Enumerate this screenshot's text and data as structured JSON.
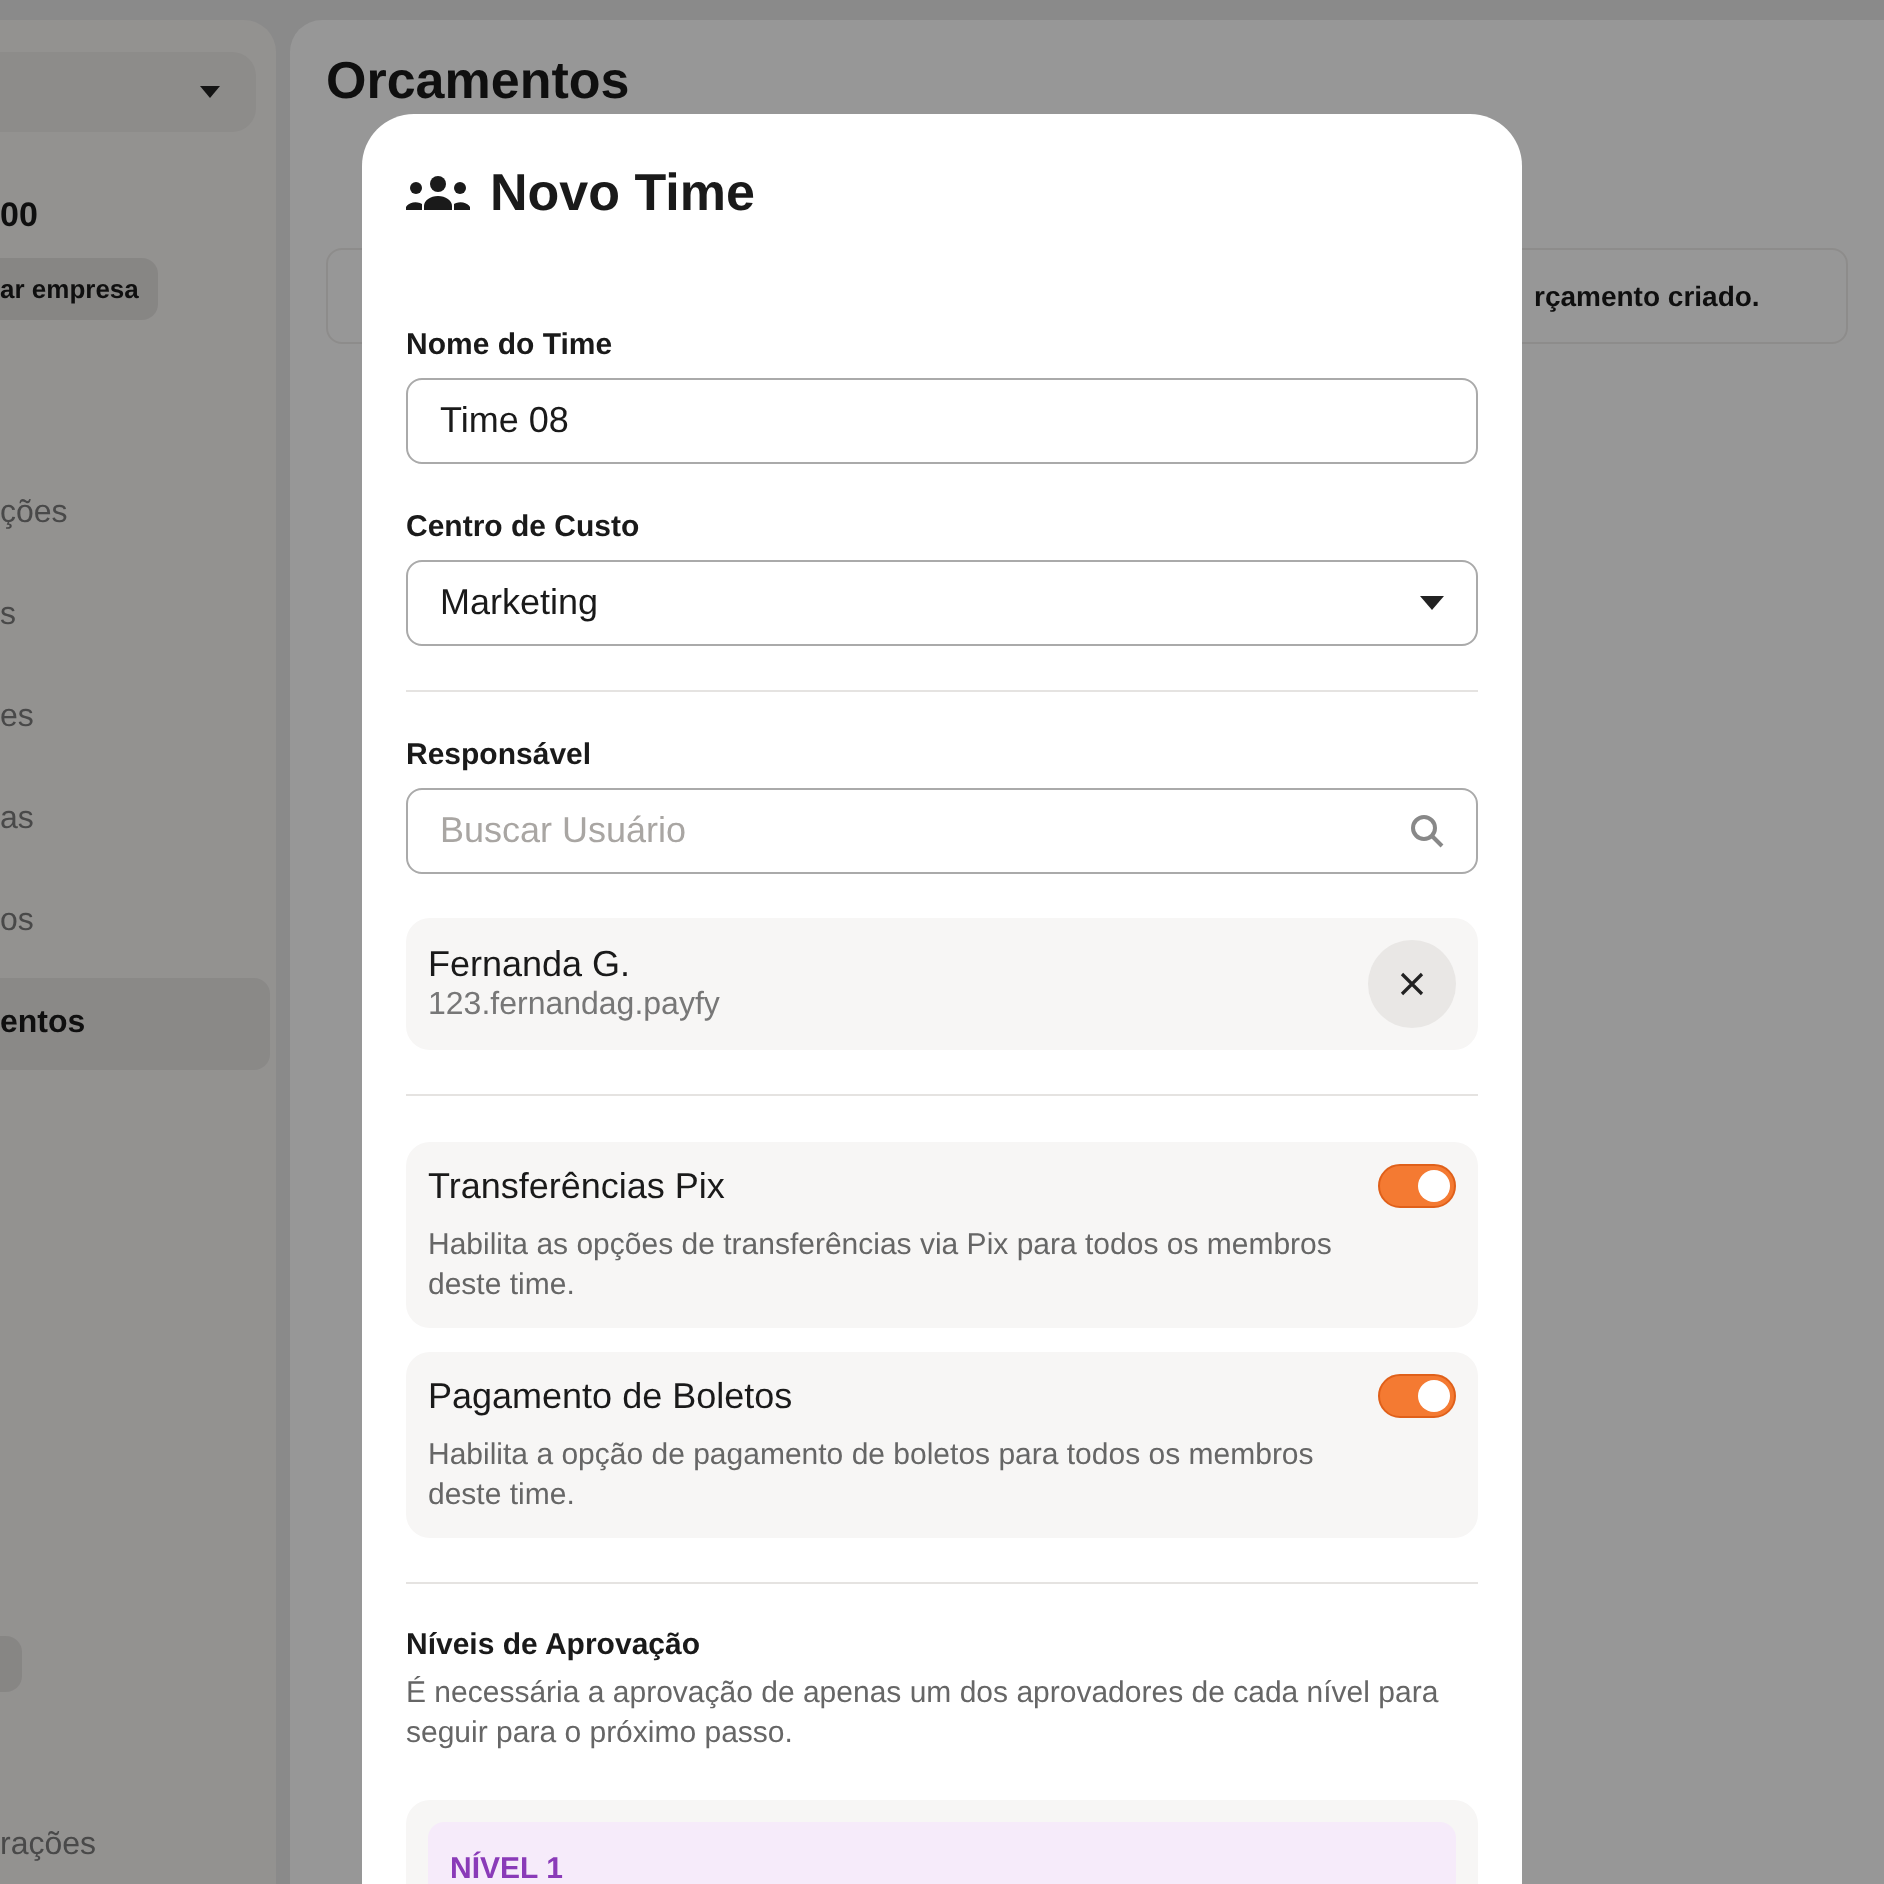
{
  "sidebar": {
    "balance": "00",
    "company_button": "ar empresa",
    "items": [
      {
        "label": "ções",
        "selected": false
      },
      {
        "label": "s",
        "selected": false
      },
      {
        "label": "es",
        "selected": false
      },
      {
        "label": "as",
        "selected": false
      },
      {
        "label": "os",
        "selected": false
      },
      {
        "label": "entos",
        "selected": true
      }
    ],
    "footer_item": "rações"
  },
  "page": {
    "title": "Orcamentos",
    "notice": "rçamento criado."
  },
  "modal": {
    "title": "Novo Time",
    "fields": [
      {
        "label": "Nome do Time",
        "kind": "text",
        "value": "Time 08"
      },
      {
        "label": "Centro de Custo",
        "kind": "select",
        "value": "Marketing"
      }
    ],
    "responsible": {
      "label": "Responsável",
      "search": {
        "placeholder": "Buscar Usuário"
      },
      "selected_user": {
        "name": "Fernanda G.",
        "username": "123.fernandag.payfy"
      }
    },
    "permissions": [
      {
        "title": "Transferências Pix",
        "description": "Habilita as opções de transferências via Pix para todos os membros deste time.",
        "on": true
      },
      {
        "title": "Pagamento de Boletos",
        "description": "Habilita a opção de pagamento de boletos para todos os membros deste time.",
        "on": true
      }
    ],
    "approval": {
      "title": "Níveis de Aprovação",
      "description": "É necessária a aprovação de apenas um dos aprovadores de cada nível para seguir para o próximo passo.",
      "levels": [
        {
          "label": "NÍVEL 1"
        }
      ]
    }
  }
}
